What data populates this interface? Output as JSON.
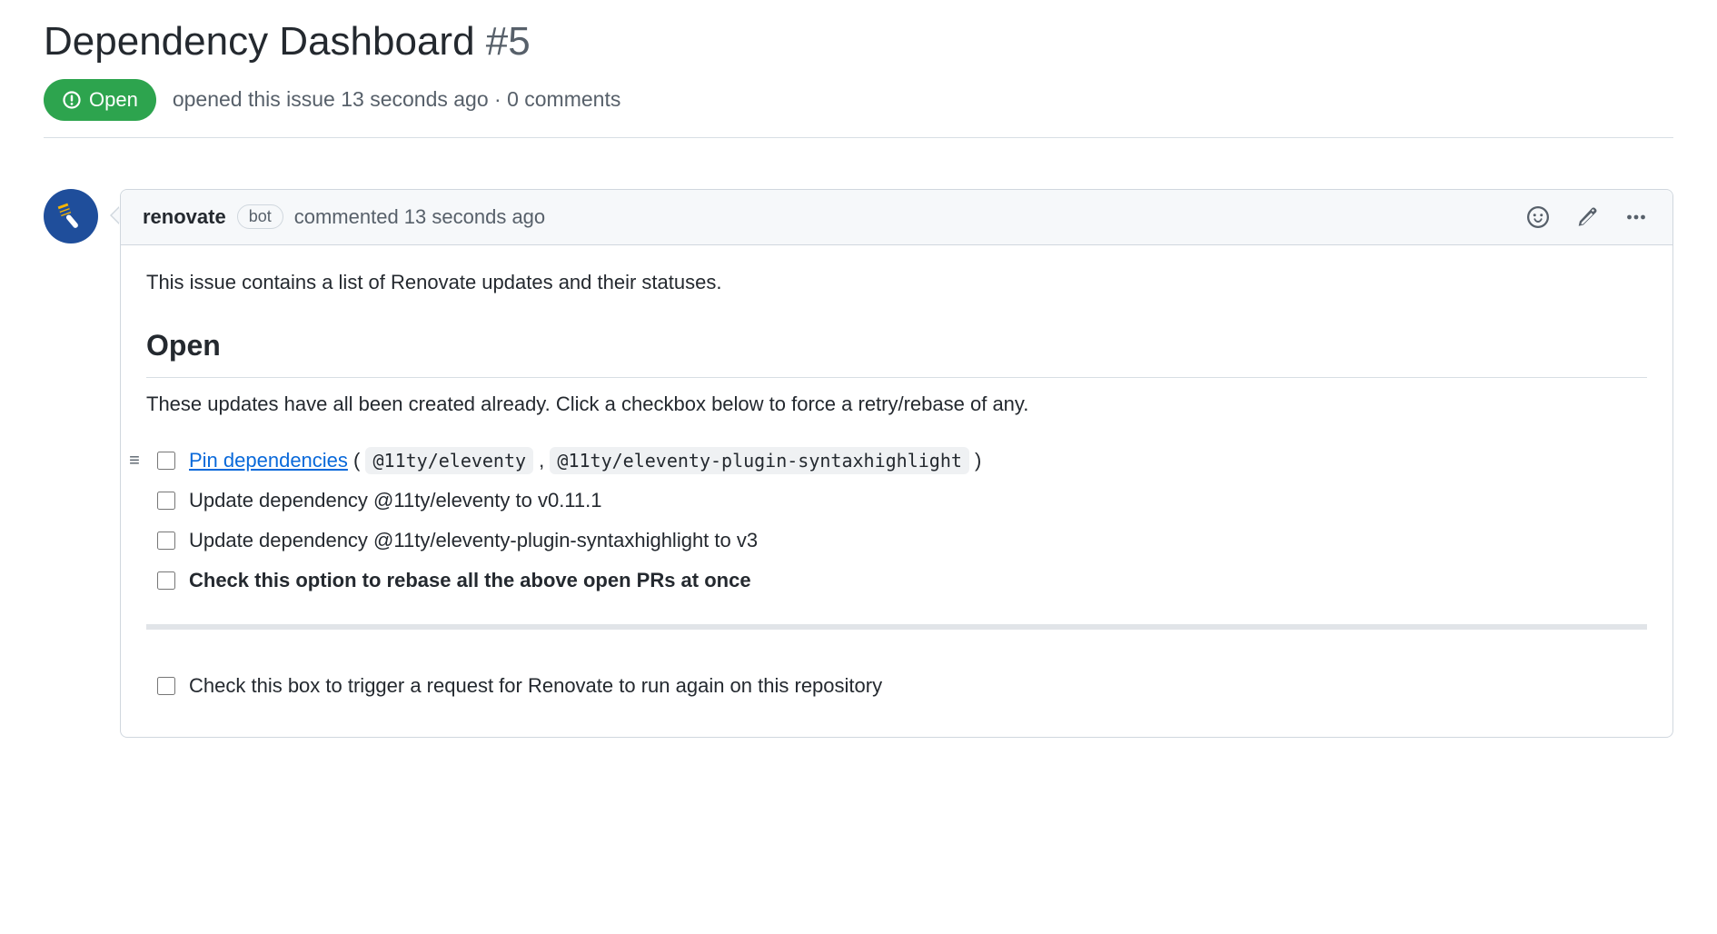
{
  "issue": {
    "title": "Dependency Dashboard",
    "number": "#5",
    "state": "Open",
    "meta": "opened this issue 13 seconds ago · 0 comments"
  },
  "comment": {
    "author": "renovate",
    "bot_label": "bot",
    "meta": "commented 13 seconds ago",
    "intro": "This issue contains a list of Renovate updates and their statuses.",
    "section_heading": "Open",
    "section_intro": "These updates have all been created already. Click a checkbox below to force a retry/rebase of any.",
    "tasks": [
      {
        "has_handle": true,
        "link_text": "Pin dependencies",
        "paren_open": " ( ",
        "code1": "@11ty/eleventy",
        "sep": " , ",
        "code2": "@11ty/eleventy-plugin-syntaxhighlight",
        "paren_close": " )"
      },
      {
        "text": "Update dependency @11ty/eleventy to v0.11.1"
      },
      {
        "text": "Update dependency @11ty/eleventy-plugin-syntaxhighlight to v3"
      },
      {
        "bold_text": "Check this option to rebase all the above open PRs at once"
      }
    ],
    "footer_task": "Check this box to trigger a request for Renovate to run again on this repository"
  }
}
